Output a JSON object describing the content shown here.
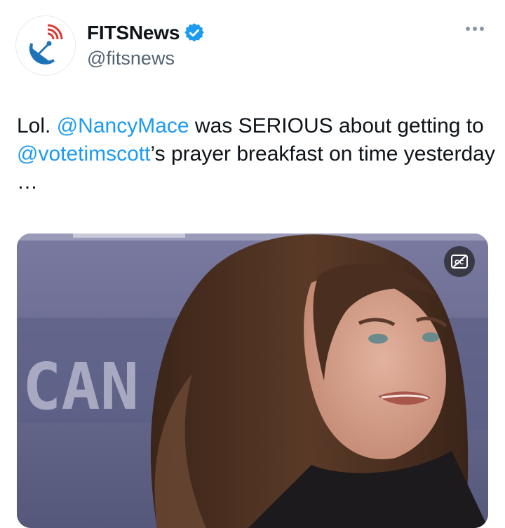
{
  "header": {
    "display_name": "FITSNews",
    "handle": "@fitsnews",
    "verified": true,
    "avatar_icon": "satellite-dish-icon",
    "more_icon": "more-horizontal-icon"
  },
  "tweet": {
    "text_parts": {
      "p1": "Lol. ",
      "m1": "@NancyMace",
      "p2": " was SERIOUS about getting to ",
      "m2": "@votetimscott",
      "p3": "’s prayer breakfast on time yesterday …"
    }
  },
  "media": {
    "type": "video",
    "background_sign_text": "CAN",
    "captions_icon": "closed-captions-off-icon"
  },
  "colors": {
    "link": "#1d9bf0",
    "verified": "#1d9bf0",
    "text": "#0f1419",
    "secondary": "#536471"
  }
}
